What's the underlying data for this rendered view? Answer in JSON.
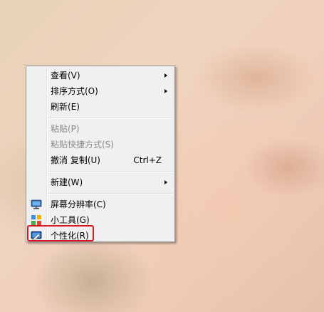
{
  "context_menu": {
    "items": [
      {
        "label": "查看(V)",
        "disabled": false,
        "submenu": true
      },
      {
        "label": "排序方式(O)",
        "disabled": false,
        "submenu": true
      },
      {
        "label": "刷新(E)",
        "disabled": false
      },
      {
        "label": "粘贴(P)",
        "disabled": true
      },
      {
        "label": "粘贴快捷方式(S)",
        "disabled": true
      },
      {
        "label": "撤消 复制(U)",
        "shortcut": "Ctrl+Z",
        "disabled": false
      },
      {
        "label": "新建(W)",
        "disabled": false,
        "submenu": true
      },
      {
        "label": "屏幕分辨率(C)",
        "icon": "monitor-icon",
        "disabled": false
      },
      {
        "label": "小工具(G)",
        "icon": "gadgets-icon",
        "disabled": false
      },
      {
        "label": "个性化(R)",
        "icon": "personalize-icon",
        "disabled": false,
        "highlighted_by_annotation": true
      }
    ]
  },
  "colors": {
    "menu_background": "#f0f0f0",
    "menu_border": "#979797",
    "annotation_red": "#d8161f",
    "disabled_text": "#8a8a8a"
  }
}
